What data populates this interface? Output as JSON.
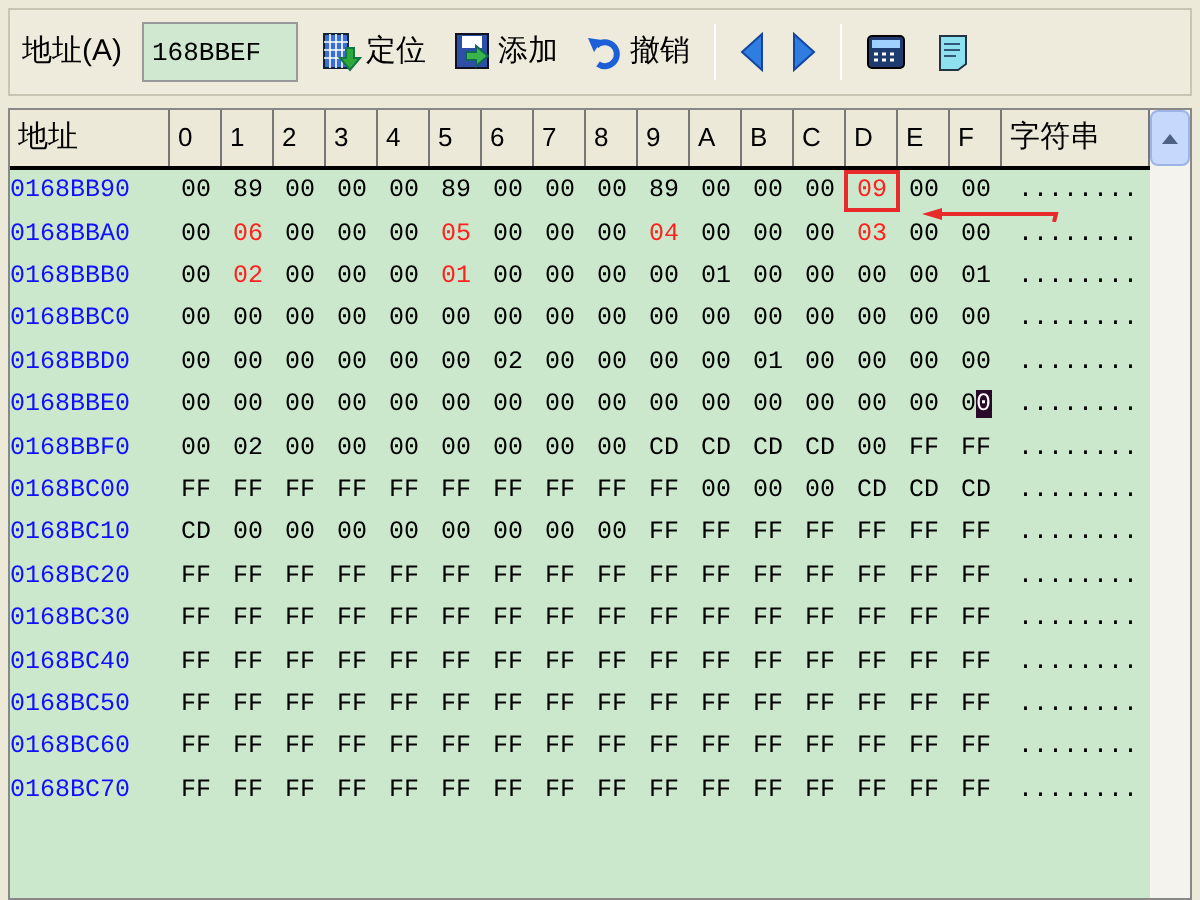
{
  "toolbar": {
    "address_label": "地址(A)",
    "address_value": "168BBEF",
    "buttons": [
      {
        "kind": "locate",
        "label": "定位"
      },
      {
        "kind": "add",
        "label": "添加"
      },
      {
        "kind": "undo",
        "label": "撤销"
      },
      {
        "kind": "prev"
      },
      {
        "kind": "next"
      },
      {
        "kind": "calculator"
      },
      {
        "kind": "notepad"
      }
    ]
  },
  "table": {
    "columns": [
      "地址",
      "0",
      "1",
      "2",
      "3",
      "4",
      "5",
      "6",
      "7",
      "8",
      "9",
      "A",
      "B",
      "C",
      "D",
      "E",
      "F",
      "字符串"
    ],
    "rows": [
      {
        "address": "0168BB90",
        "bytes": [
          "00",
          "89",
          "00",
          "00",
          "00",
          "89",
          "00",
          "00",
          "00",
          "89",
          "00",
          "00",
          "00",
          {
            "text": "09",
            "kind": "boxed"
          },
          "00",
          "00"
        ],
        "chars": "........"
      },
      {
        "address": "0168BBA0",
        "bytes": [
          "00",
          {
            "text": "06",
            "kind": "red"
          },
          "00",
          "00",
          "00",
          {
            "text": "05",
            "kind": "red"
          },
          "00",
          "00",
          "00",
          {
            "text": "04",
            "kind": "red"
          },
          "00",
          "00",
          "00",
          {
            "text": "03",
            "kind": "red"
          },
          "00",
          "00"
        ],
        "chars": "........"
      },
      {
        "address": "0168BBB0",
        "bytes": [
          "00",
          {
            "text": "02",
            "kind": "red"
          },
          "00",
          "00",
          "00",
          {
            "text": "01",
            "kind": "red"
          },
          "00",
          "00",
          "00",
          "00",
          "01",
          "00",
          "00",
          "00",
          "00",
          "01"
        ],
        "chars": "........"
      },
      {
        "address": "0168BBC0",
        "bytes": [
          "00",
          "00",
          "00",
          "00",
          "00",
          "00",
          "00",
          "00",
          "00",
          "00",
          "00",
          "00",
          "00",
          "00",
          "00",
          "00"
        ],
        "chars": "........"
      },
      {
        "address": "0168BBD0",
        "bytes": [
          "00",
          "00",
          "00",
          "00",
          "00",
          "00",
          "02",
          "00",
          "00",
          "00",
          "00",
          "01",
          "00",
          "00",
          "00",
          "00"
        ],
        "chars": "........"
      },
      {
        "address": "0168BBE0",
        "bytes": [
          "00",
          "00",
          "00",
          "00",
          "00",
          "00",
          "00",
          "00",
          "00",
          "00",
          "00",
          "00",
          "00",
          "00",
          "00",
          {
            "text": "00",
            "kind": "cursor"
          }
        ],
        "chars": "........"
      },
      {
        "address": "0168BBF0",
        "bytes": [
          "00",
          "02",
          "00",
          "00",
          "00",
          "00",
          "00",
          "00",
          "00",
          "CD",
          "CD",
          "CD",
          "CD",
          "00",
          "FF",
          "FF"
        ],
        "chars": "........"
      },
      {
        "address": "0168BC00",
        "bytes": [
          "FF",
          "FF",
          "FF",
          "FF",
          "FF",
          "FF",
          "FF",
          "FF",
          "FF",
          "FF",
          "00",
          "00",
          "00",
          "CD",
          "CD",
          "CD"
        ],
        "chars": "........"
      },
      {
        "address": "0168BC10",
        "bytes": [
          "CD",
          "00",
          "00",
          "00",
          "00",
          "00",
          "00",
          "00",
          "00",
          "FF",
          "FF",
          "FF",
          "FF",
          "FF",
          "FF",
          "FF"
        ],
        "chars": "........"
      },
      {
        "address": "0168BC20",
        "bytes": [
          "FF",
          "FF",
          "FF",
          "FF",
          "FF",
          "FF",
          "FF",
          "FF",
          "FF",
          "FF",
          "FF",
          "FF",
          "FF",
          "FF",
          "FF",
          "FF"
        ],
        "chars": "........"
      },
      {
        "address": "0168BC30",
        "bytes": [
          "FF",
          "FF",
          "FF",
          "FF",
          "FF",
          "FF",
          "FF",
          "FF",
          "FF",
          "FF",
          "FF",
          "FF",
          "FF",
          "FF",
          "FF",
          "FF"
        ],
        "chars": "........"
      },
      {
        "address": "0168BC40",
        "bytes": [
          "FF",
          "FF",
          "FF",
          "FF",
          "FF",
          "FF",
          "FF",
          "FF",
          "FF",
          "FF",
          "FF",
          "FF",
          "FF",
          "FF",
          "FF",
          "FF"
        ],
        "chars": "........"
      },
      {
        "address": "0168BC50",
        "bytes": [
          "FF",
          "FF",
          "FF",
          "FF",
          "FF",
          "FF",
          "FF",
          "FF",
          "FF",
          "FF",
          "FF",
          "FF",
          "FF",
          "FF",
          "FF",
          "FF"
        ],
        "chars": "........"
      },
      {
        "address": "0168BC60",
        "bytes": [
          "FF",
          "FF",
          "FF",
          "FF",
          "FF",
          "FF",
          "FF",
          "FF",
          "FF",
          "FF",
          "FF",
          "FF",
          "FF",
          "FF",
          "FF",
          "FF"
        ],
        "chars": "........"
      },
      {
        "address": "0168BC70",
        "bytes": [
          "FF",
          "FF",
          "FF",
          "FF",
          "FF",
          "FF",
          "FF",
          "FF",
          "FF",
          "FF",
          "FF",
          "FF",
          "FF",
          "FF",
          "FF",
          "FF"
        ],
        "chars": "........"
      }
    ]
  }
}
